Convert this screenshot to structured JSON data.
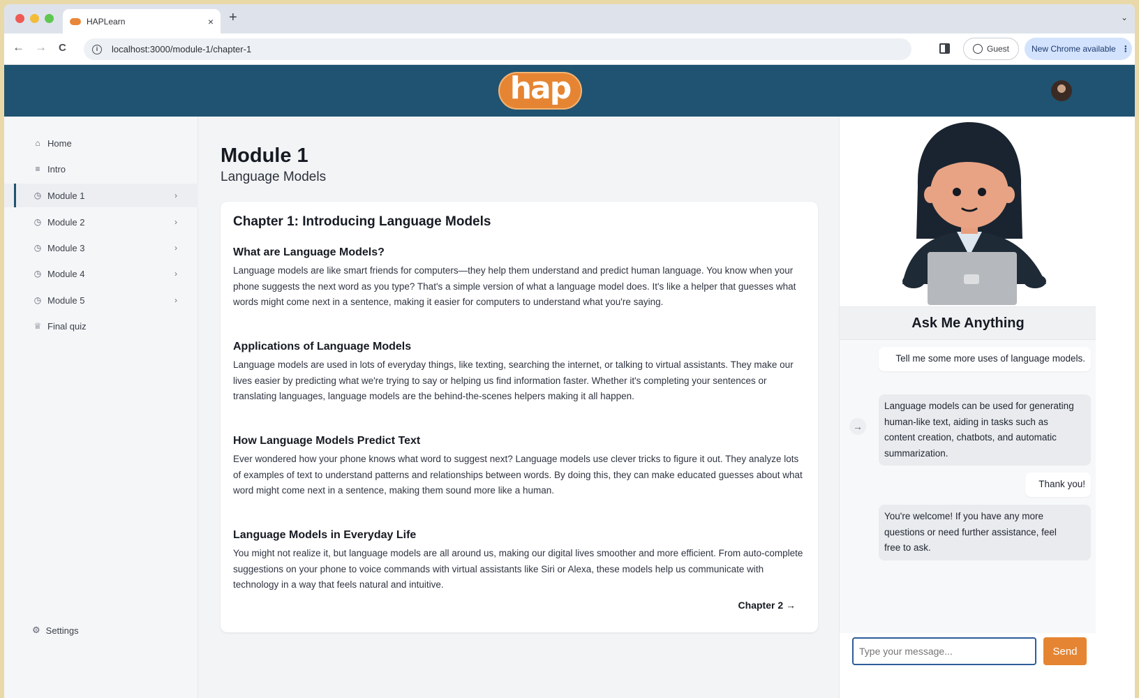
{
  "browser": {
    "tab_title": "HAPLearn",
    "tab_close": "×",
    "new_tab": "+",
    "tab_menu": "⌄",
    "url": "localhost:3000/module-1/chapter-1",
    "guest_label": "Guest",
    "update_label": "New Chrome available",
    "update_menu": "⋮",
    "back": "←",
    "forward": "→",
    "reload": "C"
  },
  "header": {
    "logo_text": "hap"
  },
  "sidebar": {
    "items": [
      {
        "icon": "⌂",
        "label": "Home",
        "chevron": ""
      },
      {
        "icon": "≡",
        "label": "Intro",
        "chevron": ""
      },
      {
        "icon": "◷",
        "label": "Module 1",
        "chevron": "›"
      },
      {
        "icon": "◷",
        "label": "Module 2",
        "chevron": "›"
      },
      {
        "icon": "◷",
        "label": "Module 3",
        "chevron": "›"
      },
      {
        "icon": "◷",
        "label": "Module 4",
        "chevron": "›"
      },
      {
        "icon": "◷",
        "label": "Module 5",
        "chevron": "›"
      },
      {
        "icon": "♕",
        "label": "Final quiz",
        "chevron": ""
      }
    ],
    "settings_label": "Settings",
    "settings_icon": "⚙"
  },
  "main": {
    "module_title": "Module 1",
    "module_subtitle": "Language Models",
    "chapter_title": "Chapter 1: Introducing Language Models",
    "sections": [
      {
        "heading": "What are Language Models?",
        "body": "Language models are like smart friends for computers—they help them understand and predict human language. You know when your phone suggests the next word as you type? That's a simple version of what a language model does. It's like a helper that guesses what words might come next in a sentence, making it easier for computers to understand what you're saying."
      },
      {
        "heading": "Applications of Language Models",
        "body": "Language models are used in lots of everyday things, like texting, searching the internet, or talking to virtual assistants. They make our lives easier by predicting what we're trying to say or helping us find information faster. Whether it's completing your sentences or translating languages, language models are the behind-the-scenes helpers making it all happen."
      },
      {
        "heading": "How Language Models Predict Text",
        "body": "Ever wondered how your phone knows what word to suggest next? Language models use clever tricks to figure it out. They analyze lots of examples of text to understand patterns and relationships between words. By doing this, they can make educated guesses about what word might come next in a sentence, making them sound more like a human."
      },
      {
        "heading": "Language Models in Everyday Life",
        "body": "You might not realize it, but language models are all around us, making our digital lives smoother and more efficient. From auto-complete suggestions on your phone to voice commands with virtual assistants like Siri or Alexa, these models help us communicate with technology in a way that feels natural and intuitive."
      }
    ],
    "next_chapter_label": "Chapter 2 →"
  },
  "chat": {
    "title": "Ask Me Anything",
    "messages": [
      {
        "role": "user",
        "text": "Tell me some more uses of language models."
      },
      {
        "role": "bot",
        "text": "Language models can be used for generating human-like text, aiding in tasks such as content creation, chatbots, and automatic summarization."
      },
      {
        "role": "user",
        "text": "Thank you!"
      },
      {
        "role": "bot",
        "text": "You're welcome! If you have any more questions or need further assistance, feel free to ask."
      }
    ],
    "arrow_icon": "→",
    "input_placeholder": "Type your message...",
    "send_label": "Send"
  },
  "colors": {
    "header_bg": "#1f5371",
    "accent_orange": "#e58533",
    "input_border": "#2d5c9a"
  }
}
